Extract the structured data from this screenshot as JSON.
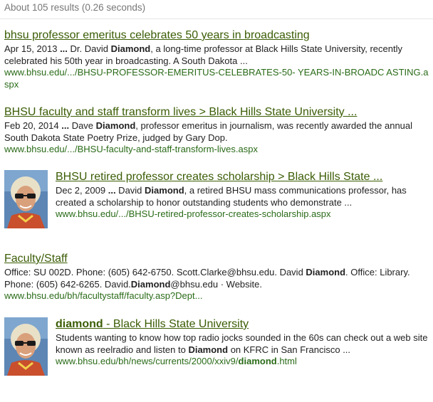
{
  "stats": {
    "text": "About 105 results (0.26 seconds)"
  },
  "results": [
    {
      "title_html": "bhsu professor emeritus celebrates 50 years in broadcasting",
      "snippet_html": "Apr 15, 2013 <b>...</b> Dr. David <b>Diamond</b>, a long-time professor at Black Hills State University, recently celebrated his 50th year in broadcasting. A South Dakota ...",
      "url_html": "www.bhsu.edu/.../BHSU-PROFESSOR-EMERITUS-CELEBRATES-50- YEARS-IN-BROADC ASTING.aspx"
    },
    {
      "title_html": "BHSU faculty and staff transform lives &gt; Black Hills State University ...",
      "snippet_html": "Feb 20, 2014 <b>...</b> Dave <b>Diamond</b>, professor emeritus in journalism, was recently awarded the annual South Dakota State Poetry Prize, judged by Gary Dop.",
      "url_html": "www.bhsu.edu/.../BHSU-faculty-and-staff-transform-lives.aspx"
    },
    {
      "title_html": "BHSU retired professor creates scholarship &gt; Black Hills State ...",
      "snippet_html": "Dec 2, 2009 <b>...</b> David <b>Diamond</b>, a retired BHSU mass communications professor, has created a scholarship to honor outstanding students who demonstrate ...",
      "url_html": "www.bhsu.edu/.../BHSU-retired-professor-creates-scholarship.aspx",
      "thumbnail": "portrait-thumbnail"
    },
    {
      "title_html": "Faculty/Staff",
      "snippet_html": "Office: SU 002D. Phone: (605) 642-6750. Scott.Clarke@bhsu.edu. David <b>Diamond</b>. Office: Library. Phone: (605) 642-6265. David.<b>Diamond</b>@bhsu.edu · Website.",
      "url_html": "www.bhsu.edu/bh/facultystaff/faculty.asp?Dept..."
    },
    {
      "title_html": "<b>diamond</b> - Black Hills State University",
      "snippet_html": "Students wanting to know how top radio jocks sounded in the 60s can check out a web site known as reelradio and listen to <b>Diamond</b> on KFRC in San Francisco ...",
      "url_html": "www.bhsu.edu/bh/news/currents/2000/xxiv9/<b>diamond</b>.html",
      "thumbnail": "portrait-thumbnail"
    }
  ],
  "colors": {
    "title": "#3b5d05",
    "url": "#2a6b18",
    "text": "#222222",
    "stats": "#777777"
  }
}
